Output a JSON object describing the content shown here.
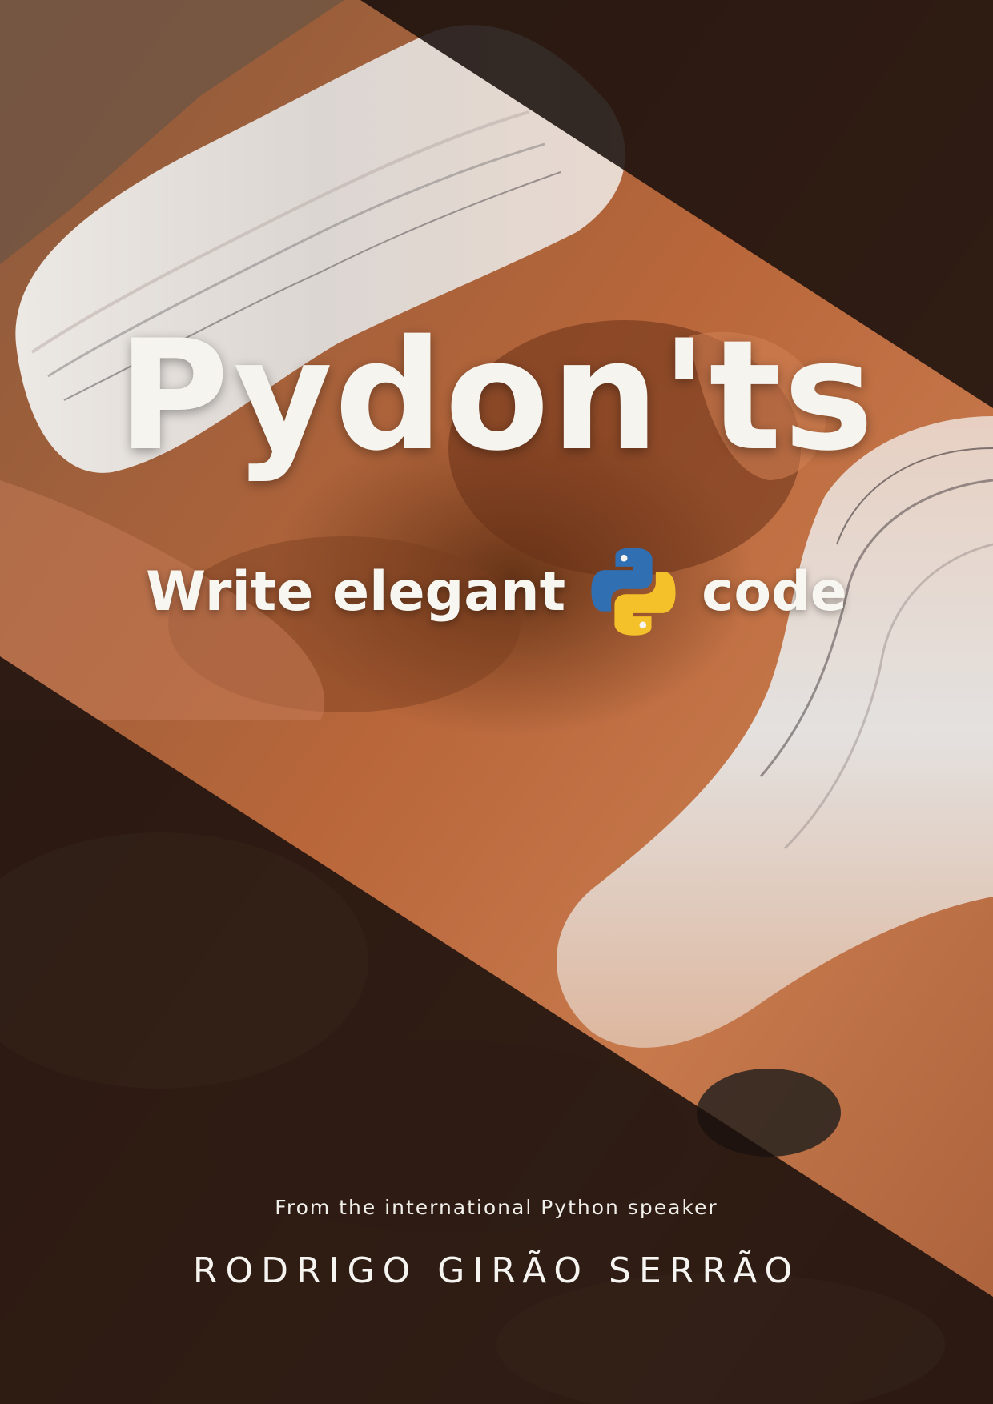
{
  "cover": {
    "title": "Pydon'ts",
    "subtitle_before_logo": "Write elegant",
    "subtitle_after_logo": "code",
    "logo_icon": "python-logo-icon",
    "tagline": "From the international Python speaker",
    "author": "RODRIGO GIRÃO SERRÃO"
  },
  "colors": {
    "title_text": "#f5f4ef",
    "python_blue": "#2f6fb2",
    "python_yellow": "#f5c12a",
    "dark_band": "#1a100c",
    "sand_orange": "#c9744a",
    "salt_white": "#e9e4df"
  }
}
